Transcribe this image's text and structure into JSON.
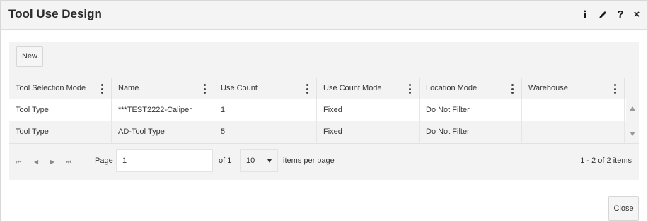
{
  "dialog": {
    "title": "Tool Use Design",
    "actions": {
      "info": "i",
      "edit": "✎",
      "help": "?",
      "close": "×"
    }
  },
  "toolbar": {
    "new_label": "New"
  },
  "grid": {
    "columns": [
      "Tool Selection Mode",
      "Name",
      "Use Count",
      "Use Count Mode",
      "Location Mode",
      "Warehouse"
    ],
    "rows": [
      [
        "Tool Type",
        "***TEST2222-Caliper",
        "1",
        "Fixed",
        "Do Not Filter",
        ""
      ],
      [
        "Tool Type",
        "AD-Tool Type",
        "5",
        "Fixed",
        "Do Not Filter",
        ""
      ]
    ]
  },
  "pager": {
    "first": "⏮",
    "prev": "◀",
    "next": "▶",
    "last": "⏭",
    "page_label": "Page",
    "page_value": "1",
    "of_label": "of 1",
    "page_size": "10",
    "items_per_page_label": "items per page",
    "range_text": "1 - 2 of 2 items"
  },
  "footer": {
    "close_label": "Close"
  }
}
